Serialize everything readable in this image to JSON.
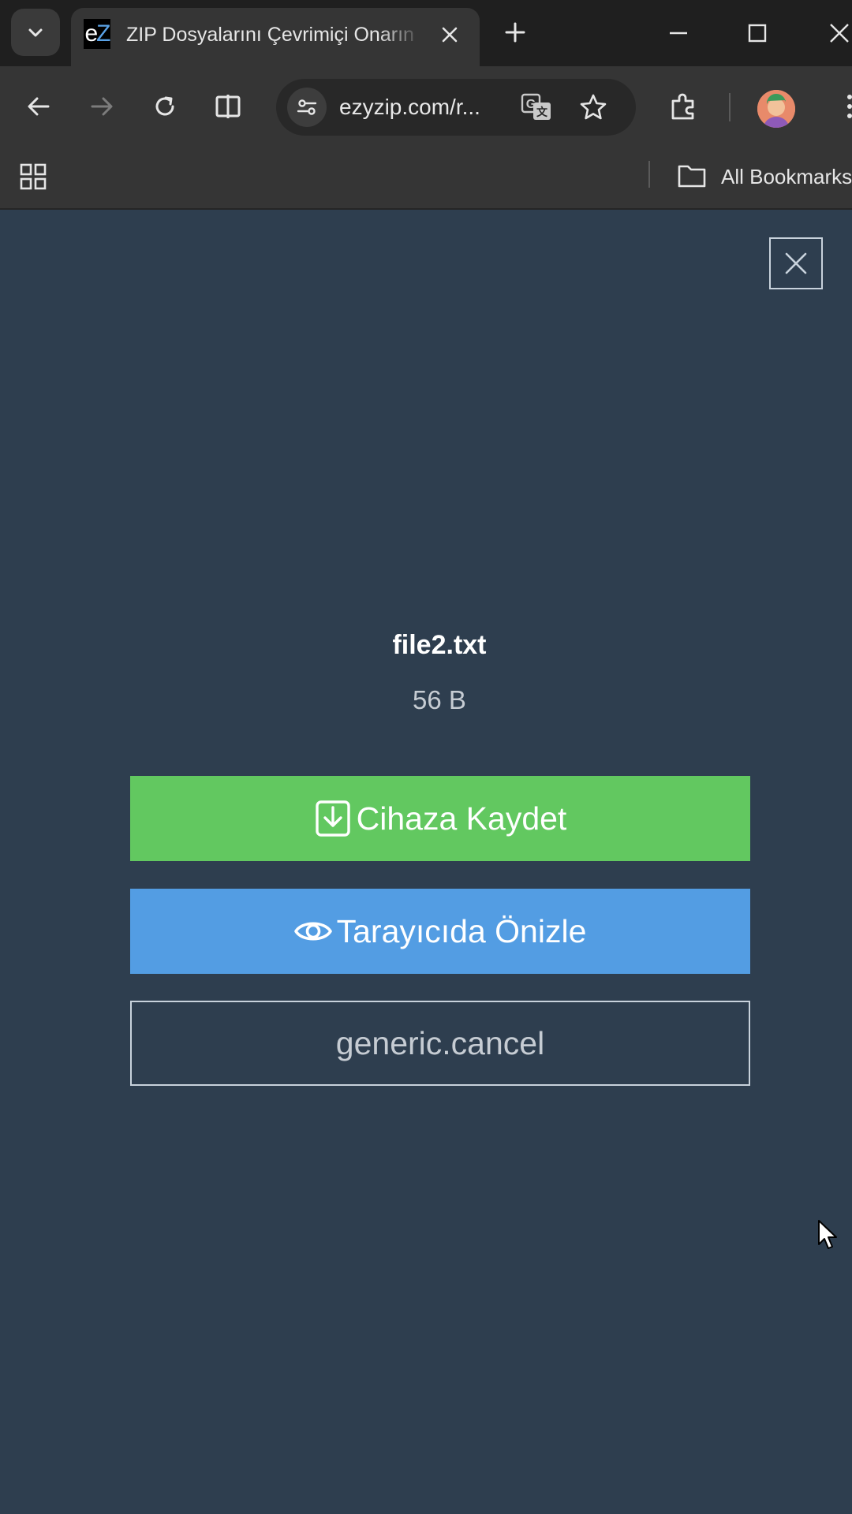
{
  "browser": {
    "tab": {
      "favicon_text": "eZ",
      "title": "ZIP Dosyalarını Çevrimiçi Onarın"
    },
    "address": {
      "url_display": "ezyzip.com/r..."
    },
    "bookmarks": {
      "all_bookmarks_label": "All Bookmarks"
    }
  },
  "dialog": {
    "file_name": "file2.txt",
    "file_size": "56 B",
    "save_button_label": "Cihaza Kaydet",
    "preview_button_label": "Tarayıcıda Önizle",
    "cancel_button_label": "generic.cancel"
  },
  "colors": {
    "page_background": "#2e3e4f",
    "save_button": "#62c860",
    "preview_button": "#539de3",
    "chrome_dark": "#1f1f1f",
    "chrome_toolbar": "#353535"
  },
  "icons": {
    "tab_search": "chevron-down-icon",
    "tab_close": "close-icon",
    "new_tab": "plus-icon",
    "back": "arrow-left-icon",
    "forward": "arrow-right-icon",
    "reload": "reload-icon",
    "split": "split-view-icon",
    "site_info": "tune-icon",
    "translate": "translate-icon",
    "bookmark": "star-icon",
    "extensions": "puzzle-icon",
    "apps": "apps-grid-icon",
    "folder": "folder-icon",
    "dialog_close": "close-icon",
    "save": "download-icon",
    "preview": "eye-icon"
  }
}
